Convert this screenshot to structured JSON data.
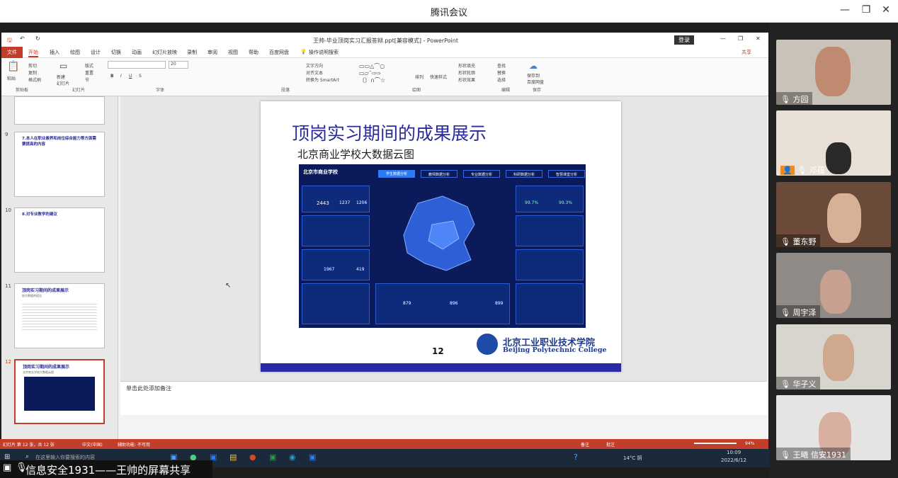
{
  "window": {
    "title": "腾讯会议"
  },
  "ppt": {
    "doc_title": "王帅-毕业顶岗实习汇报答辩.ppt[兼容模式] - PowerPoint",
    "login_button": "登录",
    "share_button": "共享",
    "tabs": [
      "文件",
      "开始",
      "插入",
      "绘图",
      "设计",
      "切换",
      "动画",
      "幻灯片放映",
      "录制",
      "审阅",
      "视图",
      "帮助",
      "百度网盘",
      "操作说明搜索"
    ],
    "groups": {
      "clipboard": "剪贴板",
      "slides": "幻灯片",
      "font": "字体",
      "paragraph": "段落",
      "drawing": "绘图",
      "editing": "编辑",
      "save": "保存"
    },
    "ribbon_items": {
      "paste": "粘贴",
      "cut": "剪切",
      "copy": "复制",
      "format_painter": "格式刷",
      "new_slide": "新建\n幻灯片",
      "layout": "版式",
      "reset": "重置",
      "section": "节",
      "font_size": "20",
      "text_direction": "文字方向",
      "align_text": "对齐文本",
      "smartart": "转换为 SmartArt",
      "arrange": "排列",
      "quick_styles": "快速样式",
      "shape_fill": "形状填充",
      "shape_outline": "形状轮廓",
      "shape_effects": "形状效果",
      "find": "查找",
      "replace": "替换",
      "select": "选择",
      "save_baidu": "保存到\n百度网盘"
    },
    "thumbnails": [
      {
        "num": "9",
        "title": "7.本人在职业素养和岗位综合能力等方面需要提高的内容"
      },
      {
        "num": "10",
        "title": "8.对专业教学的建议"
      },
      {
        "num": "11",
        "title": "顶岗实习期间的成果展示",
        "sub": "校方数据库报告"
      },
      {
        "num": "12",
        "title": "顶岗实习期间的成果展示",
        "sub": "北京商业学校大数据云图"
      }
    ],
    "slide": {
      "title": "顶岗实习期间的成果展示",
      "subtitle": "北京商业学校大数据云图",
      "page_number": "12",
      "college_cn": "北京工业职业技术学院",
      "college_en": "Beijing Polytechnic College",
      "dashboard": {
        "school": "北京市商业学校",
        "tabs": [
          "学生数据分析",
          "教师数据分析",
          "专业数据分析",
          "科研数据分析",
          "智慧课堂分析"
        ],
        "stats": [
          "2443",
          "1237",
          "1206",
          "99.7%",
          "99.3%",
          "1967",
          "419",
          "879",
          "896",
          "899"
        ]
      }
    },
    "notes_placeholder": "单击此处添加备注",
    "status": {
      "slide_info": "幻灯片 第 12 张，共 12 张",
      "language": "中文(中国)",
      "accessibility": "辅助功能: 不可用",
      "notes": "备注",
      "comments": "批注",
      "zoom": "94%"
    }
  },
  "taskbar": {
    "search_placeholder": "在这里输入你要搜索的内容",
    "weather": "14°C 阴",
    "time": "10:09",
    "date": "2022/6/12"
  },
  "share_banner": "信息安全1931——王帅的屏幕共享",
  "participants": [
    {
      "name": "方园",
      "bg": "#c9c2b8"
    },
    {
      "name": "邓蕴",
      "bg": "#e8e0d6"
    },
    {
      "name": "董东野",
      "bg": "#6b4a3a"
    },
    {
      "name": "周宇泽",
      "bg": "#8f8a86"
    },
    {
      "name": "华子义",
      "bg": "#d8d4ce"
    },
    {
      "name": "王曦   信安1931",
      "bg": "#e6e4e2"
    }
  ]
}
